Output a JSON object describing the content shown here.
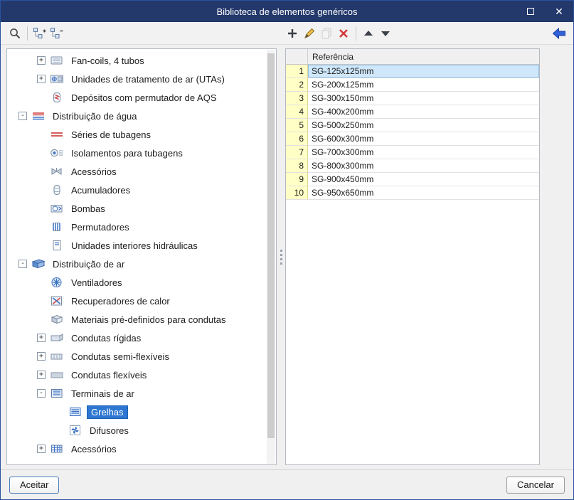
{
  "window": {
    "title": "Biblioteca de elementos genéricos"
  },
  "titlebar": {
    "icons": [
      "maximize-icon",
      "close-icon"
    ]
  },
  "toolbar": {
    "left_icons": [
      "search-icon",
      "expand-all-icon",
      "collapse-all-icon"
    ],
    "table_icons": [
      "add-icon",
      "edit-icon",
      "copy-icon",
      "delete-icon",
      "move-up-icon",
      "move-down-icon"
    ],
    "right_icons": [
      "import-arrow-icon"
    ]
  },
  "tree": {
    "items": [
      {
        "label": "Fan-coils, 4 tubos",
        "level": 2,
        "expander": "+",
        "icon": "fan-coil-icon",
        "selected": false
      },
      {
        "label": "Unidades de tratamento de ar (UTAs)",
        "level": 2,
        "expander": "+",
        "icon": "uta-icon",
        "selected": false
      },
      {
        "label": "Depósitos com permutador de AQS",
        "level": 2,
        "expander": null,
        "icon": "aqs-tank-icon",
        "selected": false
      },
      {
        "label": "Distribuição de água",
        "level": 1,
        "expander": "-",
        "icon": "water-distribution-icon",
        "selected": false
      },
      {
        "label": "Séries de tubagens",
        "level": 2,
        "expander": null,
        "icon": "pipe-series-icon",
        "selected": false
      },
      {
        "label": "Isolamentos para tubagens",
        "level": 2,
        "expander": null,
        "icon": "pipe-insulation-icon",
        "selected": false
      },
      {
        "label": "Acessórios",
        "level": 2,
        "expander": null,
        "icon": "pipe-accessories-icon",
        "selected": false
      },
      {
        "label": "Acumuladores",
        "level": 2,
        "expander": null,
        "icon": "accumulator-icon",
        "selected": false
      },
      {
        "label": "Bombas",
        "level": 2,
        "expander": null,
        "icon": "pump-icon",
        "selected": false
      },
      {
        "label": "Permutadores",
        "level": 2,
        "expander": null,
        "icon": "heat-exchanger-icon",
        "selected": false
      },
      {
        "label": "Unidades interiores hidráulicas",
        "level": 2,
        "expander": null,
        "icon": "hydraulic-indoor-unit-icon",
        "selected": false
      },
      {
        "label": "Distribuição de ar",
        "level": 1,
        "expander": "-",
        "icon": "air-distribution-icon",
        "selected": false
      },
      {
        "label": "Ventiladores",
        "level": 2,
        "expander": null,
        "icon": "fan-icon",
        "selected": false
      },
      {
        "label": "Recuperadores de calor",
        "level": 2,
        "expander": null,
        "icon": "heat-recovery-icon",
        "selected": false
      },
      {
        "label": "Materiais pré-definidos para condutas",
        "level": 2,
        "expander": null,
        "icon": "duct-material-icon",
        "selected": false
      },
      {
        "label": "Condutas rígidas",
        "level": 2,
        "expander": "+",
        "icon": "rigid-duct-icon",
        "selected": false
      },
      {
        "label": "Condutas semi-flexíveis",
        "level": 2,
        "expander": "+",
        "icon": "semi-flexible-duct-icon",
        "selected": false
      },
      {
        "label": "Condutas flexíveis",
        "level": 2,
        "expander": "+",
        "icon": "flexible-duct-icon",
        "selected": false
      },
      {
        "label": "Terminais de ar",
        "level": 2,
        "expander": "-",
        "icon": "air-terminal-icon",
        "selected": false
      },
      {
        "label": "Grelhas",
        "level": 3,
        "expander": null,
        "icon": "grille-icon",
        "selected": true
      },
      {
        "label": "Difusores",
        "level": 3,
        "expander": null,
        "icon": "diffuser-icon",
        "selected": false
      },
      {
        "label": "Acessórios",
        "level": 2,
        "expander": "+",
        "icon": "air-accessories-icon",
        "selected": false
      }
    ]
  },
  "table": {
    "header": "Referência",
    "rows": [
      {
        "num": "1",
        "ref": "SG-125x125mm",
        "selected": true
      },
      {
        "num": "2",
        "ref": "SG-200x125mm",
        "selected": false
      },
      {
        "num": "3",
        "ref": "SG-300x150mm",
        "selected": false
      },
      {
        "num": "4",
        "ref": "SG-400x200mm",
        "selected": false
      },
      {
        "num": "5",
        "ref": "SG-500x250mm",
        "selected": false
      },
      {
        "num": "6",
        "ref": "SG-600x300mm",
        "selected": false
      },
      {
        "num": "7",
        "ref": "SG-700x300mm",
        "selected": false
      },
      {
        "num": "8",
        "ref": "SG-800x300mm",
        "selected": false
      },
      {
        "num": "9",
        "ref": "SG-900x450mm",
        "selected": false
      },
      {
        "num": "10",
        "ref": "SG-950x650mm",
        "selected": false
      }
    ]
  },
  "buttons": {
    "accept": "Aceitar",
    "cancel": "Cancelar"
  },
  "colors": {
    "titlebar": "#23386b",
    "tree_selection": "#2d77d2",
    "row_number_bg": "#ffffc6",
    "selected_row_bg": "#cfe7fb",
    "accent_blue": "#3c72c4",
    "accent_red": "#d04545"
  }
}
